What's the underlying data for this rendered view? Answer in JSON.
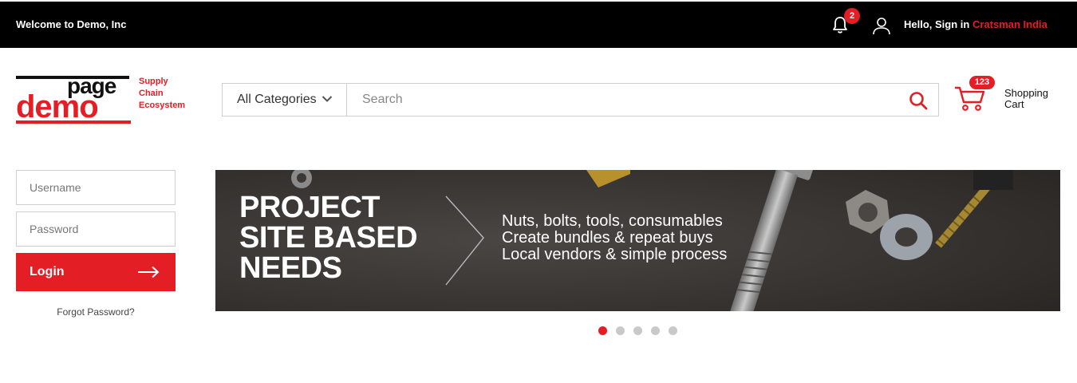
{
  "topbar": {
    "welcome": "Welcome to Demo, Inc",
    "notifications_count": "2",
    "signin_prefix": "Hello, Sign in",
    "signin_brand": "Cratsman India"
  },
  "logo": {
    "word_top": "page",
    "word_bottom": "demo",
    "tagline": [
      "Supply",
      "Chain",
      "Ecosystem"
    ]
  },
  "search": {
    "category": "All Categories",
    "placeholder": "Search"
  },
  "cart": {
    "count": "123",
    "label_line1": "Shopping",
    "label_line2": "Cart"
  },
  "login": {
    "username_placeholder": "Username",
    "password_placeholder": "Password",
    "button": "Login",
    "forgot": "Forgot Password?"
  },
  "banner": {
    "headline": [
      "PROJECT",
      "SITE BASED",
      "NEEDS"
    ],
    "lines": [
      "Nuts, bolts, tools, consumables",
      "Create bundles & repeat buys",
      "Local vendors & simple process"
    ],
    "slide_count": 5,
    "active_slide": 1
  },
  "colors": {
    "accent": "#e31e24",
    "topbar": "#000000"
  },
  "icons": [
    "bell-icon",
    "user-icon",
    "chevron-down-icon",
    "search-icon",
    "cart-icon",
    "arrow-right-icon"
  ]
}
